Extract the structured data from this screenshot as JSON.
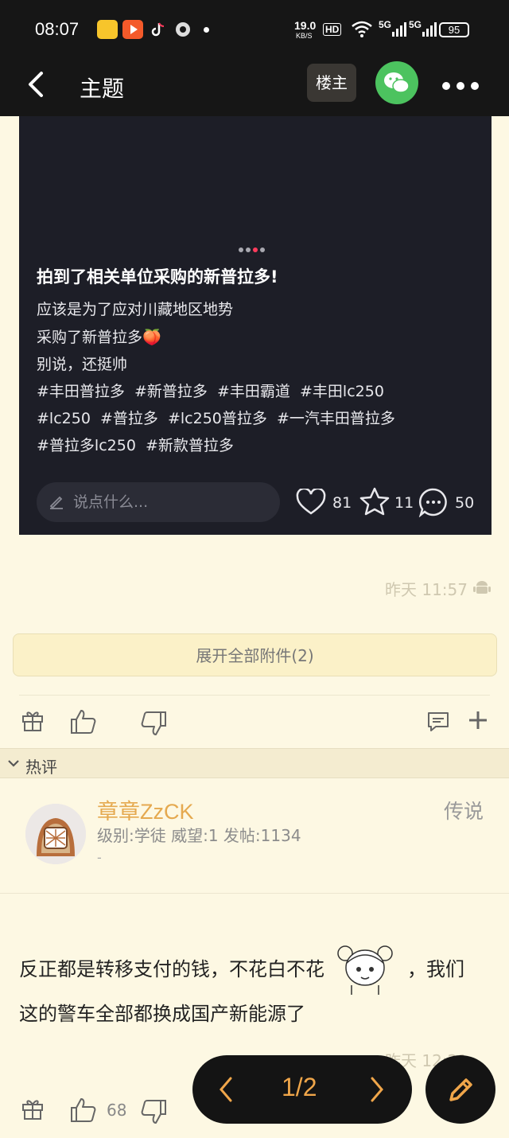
{
  "status_bar": {
    "time": "08:07",
    "speed_value": "19.0",
    "speed_unit": "KB/S",
    "hd": "HD",
    "net1": "5G",
    "net2": "5G",
    "battery": "95"
  },
  "header": {
    "title": "主题",
    "owner_button": "楼主",
    "icons": [
      "back-arrow-icon",
      "wechat-icon",
      "more-icon"
    ]
  },
  "embedded_post": {
    "title": "拍到了相关单位采购的新普拉多!",
    "lines": [
      "应该是为了应对川藏地区地势",
      "采购了新普拉多🍑",
      "别说，还挺帅",
      "#丰田普拉多  #新普拉多  #丰田霸道  #丰田lc250",
      "#lc250  #普拉多  #lc250普拉多  #一汽丰田普拉多",
      "#普拉多lc250  #新款普拉多"
    ],
    "comment_placeholder": "说点什么...",
    "likes": "81",
    "favorites": "11",
    "comments": "50"
  },
  "post_meta": {
    "time": "昨天 11:57",
    "expand_attachments": "展开全部附件(2)"
  },
  "hot_comments": {
    "label": "热评",
    "user": {
      "name": "章章ZzCK",
      "stats": "级别:学徒 威望:1 发帖:1134",
      "dash": "-",
      "rank": "传说"
    },
    "comment_part1": "反正都是转移支付的钱，不花白不花",
    "comment_part2": "，我们这的警车全部都换成国产新能源了",
    "time": "昨天 12:21",
    "likes": "68"
  },
  "pager": {
    "page": "1/2"
  },
  "colors": {
    "background": "#fdf8e3",
    "accent": "#f0a64a",
    "username": "#e5a94f",
    "dark_bar": "#161616"
  }
}
